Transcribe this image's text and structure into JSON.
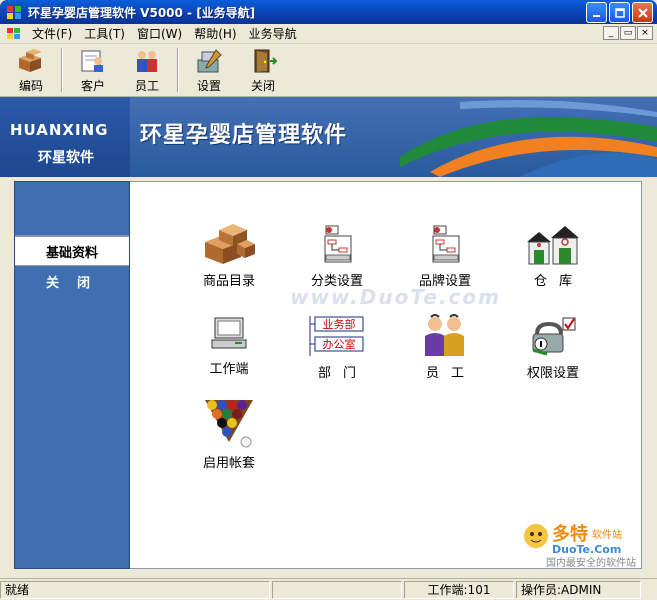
{
  "window": {
    "title": "环星孕婴店管理软件 V5000 - [业务导航]"
  },
  "menu": {
    "items": [
      "文件(F)",
      "工具(T)",
      "窗口(W)",
      "帮助(H)",
      "业务导航"
    ]
  },
  "toolbar": {
    "buttons": [
      {
        "label": "编码",
        "icon": "boxes-icon"
      },
      {
        "label": "客户",
        "icon": "customer-icon"
      },
      {
        "label": "员工",
        "icon": "employees-icon"
      },
      {
        "label": "设置",
        "icon": "settings-icon"
      },
      {
        "label": "关闭",
        "icon": "door-exit-icon"
      }
    ]
  },
  "banner": {
    "logo_en": "HUANXING",
    "logo_cn": "环星软件",
    "app_title": "环星孕婴店管理软件"
  },
  "sidebar": {
    "items": [
      {
        "label": "基础资料",
        "active": true
      },
      {
        "label": "关闭",
        "active": false
      }
    ]
  },
  "grid": {
    "items": [
      {
        "label": "商品目录",
        "icon": "boxes-icon"
      },
      {
        "label": "分类设置",
        "icon": "flowchart-icon"
      },
      {
        "label": "品牌设置",
        "icon": "flowchart-icon"
      },
      {
        "label": "仓库",
        "icon": "warehouse-icon"
      },
      {
        "label": "工作端",
        "icon": "computer-icon"
      },
      {
        "label": "部门",
        "icon": "org-chart-icon",
        "tags": [
          "业务部",
          "办公室"
        ]
      },
      {
        "label": "员工",
        "icon": "employees-icon"
      },
      {
        "label": "权限设置",
        "icon": "permission-icon"
      },
      {
        "label": "启用帐套",
        "icon": "billiard-rack-icon"
      }
    ]
  },
  "watermark": {
    "text": "www.DuoTe.com"
  },
  "badge": {
    "brand": "多特",
    "sub": "软件站",
    "url": "DuoTe.Com",
    "tag": "国内最安全的软件站"
  },
  "status": {
    "ready": "就绪",
    "workstation": "工作端:101",
    "operator": "操作员:ADMIN"
  },
  "colors": {
    "titlebar": "#0b3fb3",
    "sidebar": "#3f6fb0",
    "banner": "#2a5a9e"
  }
}
